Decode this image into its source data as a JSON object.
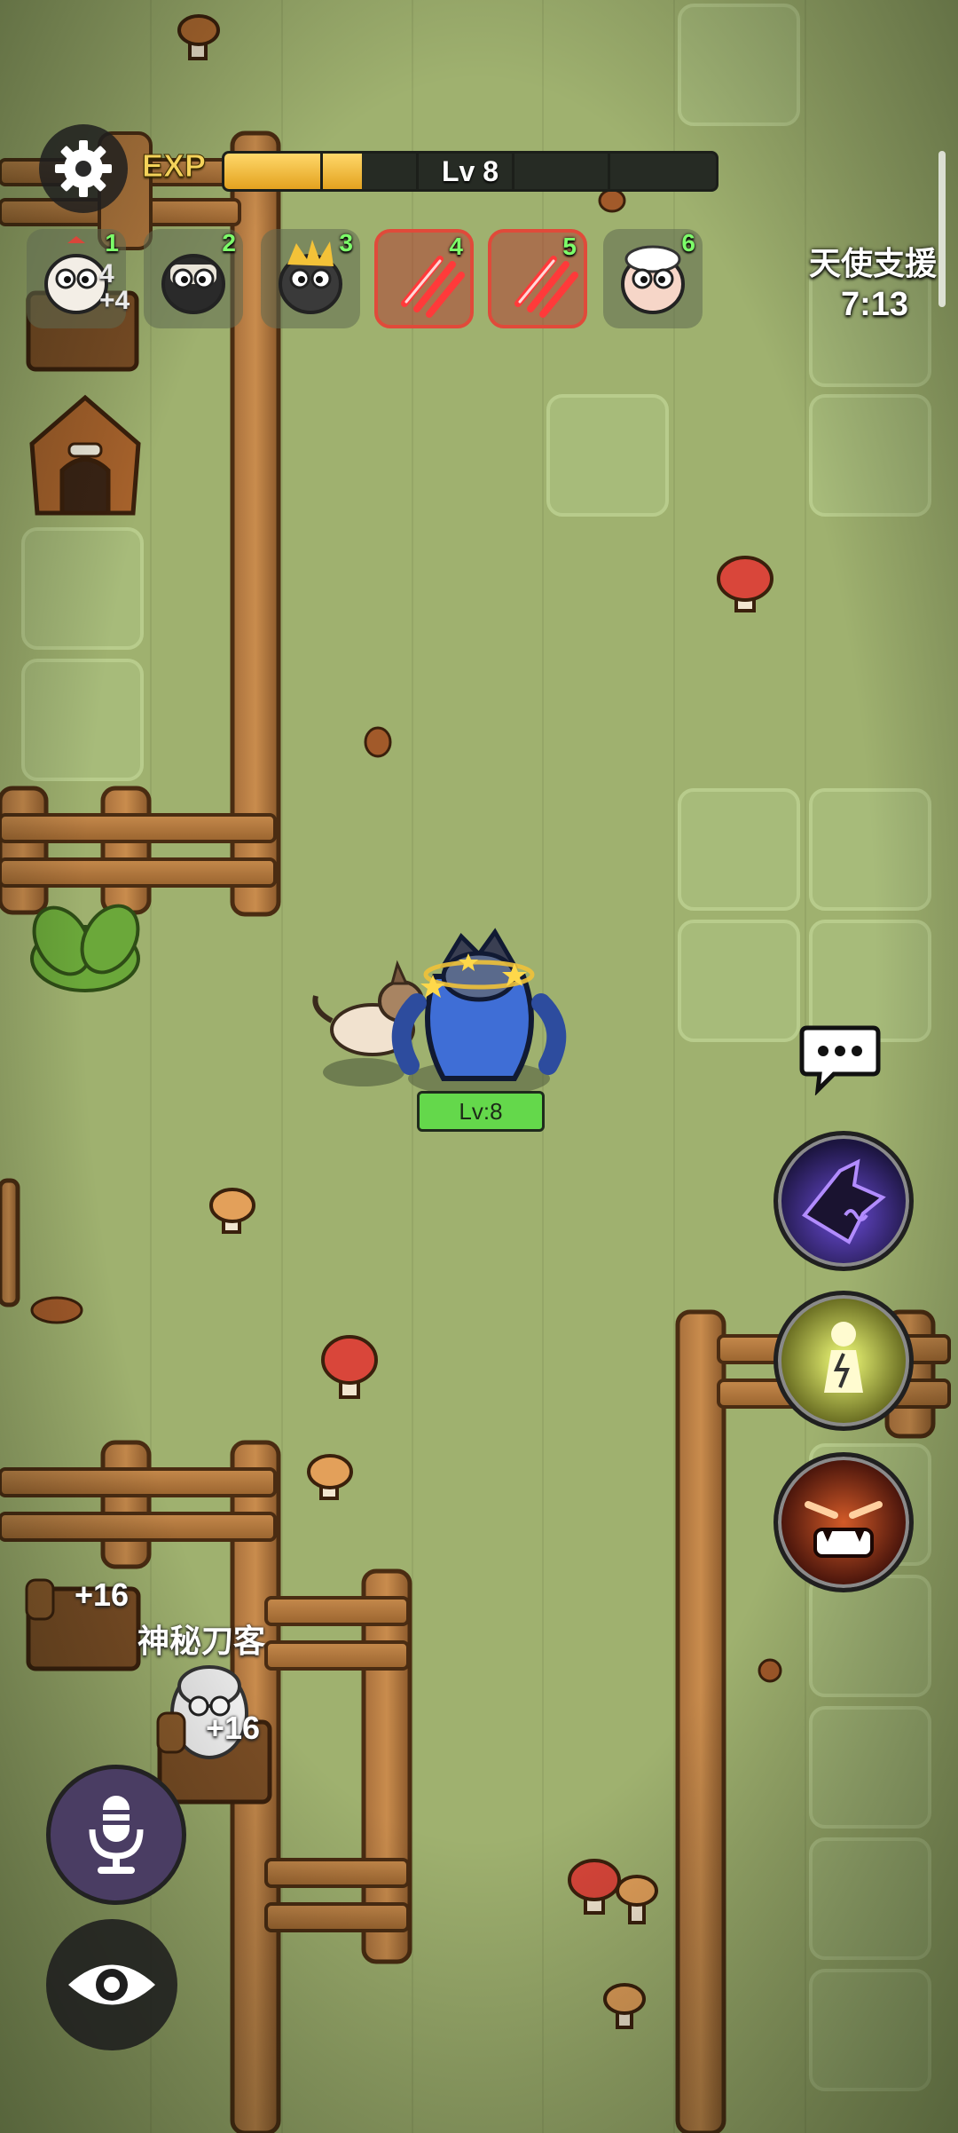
{
  "hud": {
    "exp_label": "EXP",
    "level_text": "Lv 8",
    "exp_progress": 0.28,
    "slots": [
      {
        "num": "1",
        "icon": "chicken-face-icon",
        "extra": "4\n+4",
        "danger": false
      },
      {
        "num": "2",
        "icon": "ninja-face-icon",
        "extra": "",
        "danger": false
      },
      {
        "num": "3",
        "icon": "spiky-hair-face-icon",
        "extra": "",
        "danger": false
      },
      {
        "num": "4",
        "icon": "claw-slash-icon",
        "extra": "",
        "danger": true
      },
      {
        "num": "5",
        "icon": "claw-slash-icon",
        "extra": "",
        "danger": true
      },
      {
        "num": "6",
        "icon": "sheep-face-icon",
        "extra": "",
        "danger": false
      }
    ],
    "angel_title": "天使支援",
    "angel_timer": "7:13"
  },
  "player": {
    "level_badge": "Lv:8"
  },
  "world": {
    "npc_name": "神秘刀客",
    "gain_text_1": "+16",
    "gain_text_2": "+16"
  },
  "colors": {
    "grass": "#9fb16f",
    "exp_fill": "#f0b83a",
    "level_badge": "#64d84b",
    "danger_border": "#e04a3a",
    "slot_number": "#7dff6a"
  }
}
